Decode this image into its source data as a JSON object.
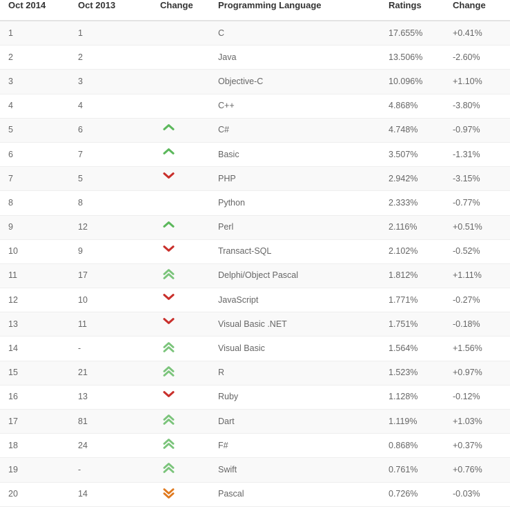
{
  "table": {
    "columns": [
      {
        "key": "rank_new",
        "label": "Oct 2014"
      },
      {
        "key": "rank_old",
        "label": "Oct 2013"
      },
      {
        "key": "change_ind",
        "label": "Change"
      },
      {
        "key": "language",
        "label": "Programming Language"
      },
      {
        "key": "ratings",
        "label": "Ratings"
      },
      {
        "key": "change_pct",
        "label": "Change"
      }
    ],
    "colors": {
      "row_odd_bg": "#f9f9f9",
      "row_even_bg": "#ffffff",
      "row_border": "#eeeeee",
      "header_border": "#e3e3e3",
      "header_text": "#333333",
      "body_text": "#666666",
      "chevron_up_green": "#5cb85c",
      "chevron_down_red": "#c9302c",
      "chevron_double_up_green": "#7bc47b",
      "chevron_double_down_orange": "#e07a1f"
    },
    "rows": [
      {
        "rank_new": "1",
        "rank_old": "1",
        "change_ind": "none",
        "language": "C",
        "ratings": "17.655%",
        "change_pct": "+0.41%"
      },
      {
        "rank_new": "2",
        "rank_old": "2",
        "change_ind": "none",
        "language": "Java",
        "ratings": "13.506%",
        "change_pct": "-2.60%"
      },
      {
        "rank_new": "3",
        "rank_old": "3",
        "change_ind": "none",
        "language": "Objective-C",
        "ratings": "10.096%",
        "change_pct": "+1.10%"
      },
      {
        "rank_new": "4",
        "rank_old": "4",
        "change_ind": "none",
        "language": "C++",
        "ratings": "4.868%",
        "change_pct": "-3.80%"
      },
      {
        "rank_new": "5",
        "rank_old": "6",
        "change_ind": "up",
        "language": "C#",
        "ratings": "4.748%",
        "change_pct": "-0.97%"
      },
      {
        "rank_new": "6",
        "rank_old": "7",
        "change_ind": "up",
        "language": "Basic",
        "ratings": "3.507%",
        "change_pct": "-1.31%"
      },
      {
        "rank_new": "7",
        "rank_old": "5",
        "change_ind": "down",
        "language": "PHP",
        "ratings": "2.942%",
        "change_pct": "-3.15%"
      },
      {
        "rank_new": "8",
        "rank_old": "8",
        "change_ind": "none",
        "language": "Python",
        "ratings": "2.333%",
        "change_pct": "-0.77%"
      },
      {
        "rank_new": "9",
        "rank_old": "12",
        "change_ind": "up",
        "language": "Perl",
        "ratings": "2.116%",
        "change_pct": "+0.51%"
      },
      {
        "rank_new": "10",
        "rank_old": "9",
        "change_ind": "down",
        "language": "Transact-SQL",
        "ratings": "2.102%",
        "change_pct": "-0.52%"
      },
      {
        "rank_new": "11",
        "rank_old": "17",
        "change_ind": "double-up",
        "language": "Delphi/Object Pascal",
        "ratings": "1.812%",
        "change_pct": "+1.11%"
      },
      {
        "rank_new": "12",
        "rank_old": "10",
        "change_ind": "down",
        "language": "JavaScript",
        "ratings": "1.771%",
        "change_pct": "-0.27%"
      },
      {
        "rank_new": "13",
        "rank_old": "11",
        "change_ind": "down",
        "language": "Visual Basic .NET",
        "ratings": "1.751%",
        "change_pct": "-0.18%"
      },
      {
        "rank_new": "14",
        "rank_old": "-",
        "change_ind": "double-up",
        "language": "Visual Basic",
        "ratings": "1.564%",
        "change_pct": "+1.56%"
      },
      {
        "rank_new": "15",
        "rank_old": "21",
        "change_ind": "double-up",
        "language": "R",
        "ratings": "1.523%",
        "change_pct": "+0.97%"
      },
      {
        "rank_new": "16",
        "rank_old": "13",
        "change_ind": "down",
        "language": "Ruby",
        "ratings": "1.128%",
        "change_pct": "-0.12%"
      },
      {
        "rank_new": "17",
        "rank_old": "81",
        "change_ind": "double-up",
        "language": "Dart",
        "ratings": "1.119%",
        "change_pct": "+1.03%"
      },
      {
        "rank_new": "18",
        "rank_old": "24",
        "change_ind": "double-up",
        "language": "F#",
        "ratings": "0.868%",
        "change_pct": "+0.37%"
      },
      {
        "rank_new": "19",
        "rank_old": "-",
        "change_ind": "double-up",
        "language": "Swift",
        "ratings": "0.761%",
        "change_pct": "+0.76%"
      },
      {
        "rank_new": "20",
        "rank_old": "14",
        "change_ind": "double-down",
        "language": "Pascal",
        "ratings": "0.726%",
        "change_pct": "-0.03%"
      }
    ]
  }
}
